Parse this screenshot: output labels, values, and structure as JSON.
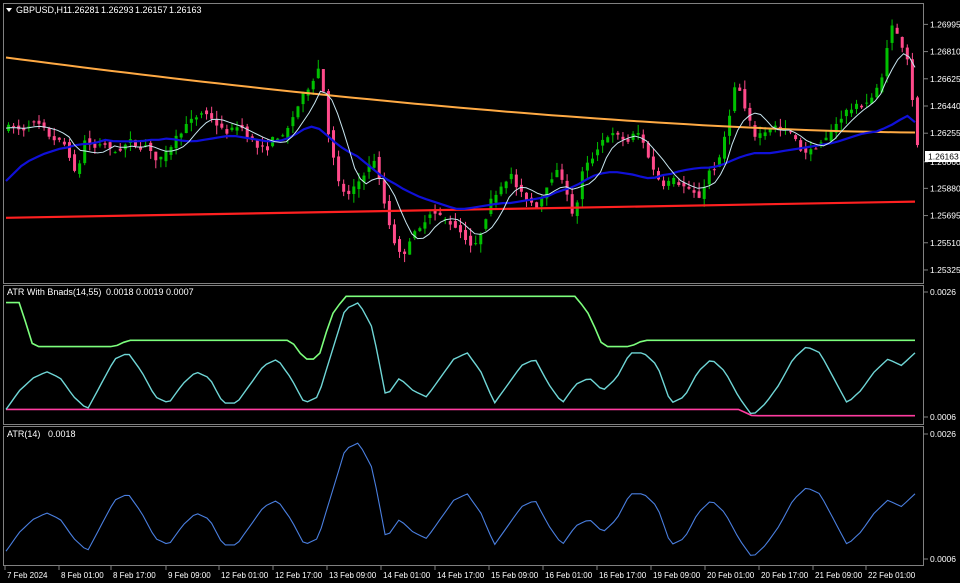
{
  "main": {
    "header": {
      "symbol": "GBPUSD,H1",
      "open": "1.26281",
      "high": "1.26293",
      "low": "1.26157",
      "close": "1.26163"
    },
    "price_levels": [
      "1.26995",
      "1.26810",
      "1.26625",
      "1.26440",
      "1.26255",
      "1.26060",
      "1.25880",
      "1.25695",
      "1.25510",
      "1.25325"
    ],
    "current_price": "1.26163"
  },
  "atr_bands": {
    "name": "ATR With Bnads(14,55)",
    "values": "0.0018 0.0019 0.0007",
    "scale_top": "0.0026",
    "scale_bottom": "0.0006"
  },
  "atr": {
    "name": "ATR(14)",
    "value": "0.0018",
    "scale_top": "0.0026",
    "scale_bottom": "0.0006"
  },
  "time_axis": [
    "7 Feb 2024",
    "8 Feb 01:00",
    "8 Feb 17:00",
    "9 Feb 09:00",
    "12 Feb 01:00",
    "12 Feb 17:00",
    "13 Feb 09:00",
    "14 Feb 01:00",
    "14 Feb 17:00",
    "15 Feb 09:00",
    "16 Feb 01:00",
    "16 Feb 17:00",
    "19 Feb 09:00",
    "20 Feb 01:00",
    "20 Feb 17:00",
    "21 Feb 09:00",
    "22 Feb 01:00"
  ],
  "colors": {
    "background": "#000000",
    "grid": "#808080",
    "bull_candle": "#00c000",
    "bear_candle": "#ff4a8a",
    "ma_fast": "#c8e6f0",
    "ma_blue": "#1010d8",
    "ma_orange": "#ffaa44",
    "ma_red": "#ff2020",
    "atr_line": "#6fd6d6",
    "upper_band": "#7dff7d",
    "lower_band": "#ff3ca0",
    "atr_plain": "#4a7fe0"
  },
  "chart_data": [
    {
      "type": "candlestick",
      "title": "GBPUSD,H1",
      "ylim": [
        1.2525,
        1.2712
      ],
      "close_path": [
        1.2629,
        1.263,
        1.2627,
        1.2633,
        1.2631,
        1.2624,
        1.262,
        1.2617,
        1.2595,
        1.2621,
        1.2615,
        1.262,
        1.2612,
        1.2615,
        1.262,
        1.2616,
        1.2618,
        1.2605,
        1.2612,
        1.2622,
        1.263,
        1.2635,
        1.264,
        1.2636,
        1.2628,
        1.2626,
        1.2632,
        1.2624,
        1.2616,
        1.2614,
        1.2624,
        1.2622,
        1.2637,
        1.265,
        1.266,
        1.2672,
        1.2622,
        1.2592,
        1.2582,
        1.259,
        1.26,
        1.2608,
        1.258,
        1.2555,
        1.254,
        1.2555,
        1.256,
        1.2572,
        1.257,
        1.2566,
        1.2562,
        1.2555,
        1.2546,
        1.2563,
        1.2582,
        1.259,
        1.2598,
        1.2585,
        1.258,
        1.2576,
        1.259,
        1.26,
        1.2593,
        1.2565,
        1.26,
        1.2608,
        1.262,
        1.2625,
        1.2623,
        1.262,
        1.2627,
        1.2615,
        1.2597,
        1.2591,
        1.2594,
        1.259,
        1.2585,
        1.2582,
        1.26,
        1.2604,
        1.2632,
        1.2662,
        1.264,
        1.2624,
        1.2626,
        1.2631,
        1.2628,
        1.2626,
        1.2615,
        1.2612,
        1.2618,
        1.2622,
        1.2632,
        1.264,
        1.2643,
        1.2645,
        1.265,
        1.266,
        1.27,
        1.269,
        1.2675,
        1.2616
      ],
      "ma_blue": [
        1.2593,
        1.2599,
        1.2605,
        1.2608,
        1.2611,
        1.2613,
        1.2615,
        1.2616,
        1.2618,
        1.2618,
        1.2619,
        1.2621,
        1.262,
        1.262,
        1.262,
        1.262,
        1.2621,
        1.2621,
        1.2622,
        1.2621,
        1.262,
        1.262,
        1.2621,
        1.2622,
        1.2623,
        1.2624,
        1.2623,
        1.2622,
        1.2621,
        1.262,
        1.262,
        1.2621,
        1.2624,
        1.2628,
        1.263,
        1.2628,
        1.2622,
        1.2617,
        1.2613,
        1.261,
        1.2605,
        1.26,
        1.2595,
        1.2592,
        1.2588,
        1.2585,
        1.2582,
        1.258,
        1.2578,
        1.2576,
        1.2574,
        1.2574,
        1.2575,
        1.2576,
        1.2577,
        1.2578,
        1.2578,
        1.2579,
        1.258,
        1.2581,
        1.2582,
        1.2585,
        1.2587,
        1.2589,
        1.2592,
        1.2596,
        1.2598,
        1.2599,
        1.2599,
        1.2598,
        1.2597,
        1.2595,
        1.2595,
        1.2597,
        1.2598,
        1.26,
        1.2601,
        1.2602,
        1.2602,
        1.2603,
        1.2605,
        1.2608,
        1.261,
        1.2612,
        1.2612,
        1.2612,
        1.2613,
        1.2614,
        1.2615,
        1.2616,
        1.2617,
        1.2618,
        1.2619,
        1.2621,
        1.2623,
        1.2625,
        1.2626,
        1.2627,
        1.263,
        1.2633,
        1.2638,
        1.2633
      ],
      "ma_orange_start": 1.2677,
      "ma_orange_end": 1.2626,
      "ma_red_start": 1.2568,
      "ma_red_end": 1.2579
    },
    {
      "type": "line",
      "title": "ATR With Bnads(14,55)",
      "ylim": [
        0.0005,
        0.0026
      ],
      "atr": [
        0.0007,
        0.001,
        0.0012,
        0.0013,
        0.0012,
        0.0009,
        0.0007,
        0.0011,
        0.0015,
        0.0016,
        0.0013,
        0.0009,
        0.0008,
        0.0011,
        0.0013,
        0.0012,
        0.0008,
        0.0008,
        0.0011,
        0.0014,
        0.0015,
        0.0012,
        0.0008,
        0.0009,
        0.0016,
        0.0023,
        0.0024,
        0.002,
        0.0009,
        0.0012,
        0.001,
        0.0009,
        0.0012,
        0.0015,
        0.0016,
        0.0013,
        0.0008,
        0.0011,
        0.0014,
        0.0015,
        0.0011,
        0.0008,
        0.0011,
        0.0012,
        0.001,
        0.0012,
        0.0016,
        0.0016,
        0.0014,
        0.0008,
        0.0009,
        0.0013,
        0.0015,
        0.0013,
        0.0009,
        0.0006,
        0.0008,
        0.0011,
        0.0015,
        0.0017,
        0.0016,
        0.0012,
        0.0008,
        0.001,
        0.0013,
        0.0015,
        0.0014,
        0.0016
      ],
      "upper": [
        0.0024,
        0.0024,
        0.0017,
        0.0017,
        0.0017,
        0.0017,
        0.0017,
        0.0017,
        0.0017,
        0.0018,
        0.0018,
        0.0018,
        0.0018,
        0.0018,
        0.0018,
        0.0018,
        0.0018,
        0.0018,
        0.0018,
        0.0018,
        0.0018,
        0.0018,
        0.0015,
        0.0015,
        0.0022,
        0.0025,
        0.0025,
        0.0025,
        0.0025,
        0.0025,
        0.0025,
        0.0025,
        0.0025,
        0.0025,
        0.0025,
        0.0025,
        0.0025,
        0.0025,
        0.0025,
        0.0025,
        0.0025,
        0.0025,
        0.0025,
        0.0022,
        0.0017,
        0.0017,
        0.0017,
        0.0018,
        0.0018,
        0.0018,
        0.0018,
        0.0018,
        0.0018,
        0.0018,
        0.0018,
        0.0018,
        0.0018,
        0.0018,
        0.0018,
        0.0018,
        0.0018,
        0.0018,
        0.0018,
        0.0018,
        0.0018,
        0.0018,
        0.0018,
        0.0018
      ],
      "lower": [
        0.0007,
        0.0007,
        0.0007,
        0.0007,
        0.0007,
        0.0007,
        0.0007,
        0.0007,
        0.0007,
        0.0007,
        0.0007,
        0.0007,
        0.0007,
        0.0007,
        0.0007,
        0.0007,
        0.0007,
        0.0007,
        0.0007,
        0.0007,
        0.0007,
        0.0007,
        0.0007,
        0.0007,
        0.0007,
        0.0007,
        0.0007,
        0.0007,
        0.0007,
        0.0007,
        0.0007,
        0.0007,
        0.0007,
        0.0007,
        0.0007,
        0.0007,
        0.0007,
        0.0007,
        0.0007,
        0.0007,
        0.0007,
        0.0007,
        0.0007,
        0.0007,
        0.0007,
        0.0007,
        0.0007,
        0.0007,
        0.0007,
        0.0007,
        0.0007,
        0.0007,
        0.0007,
        0.0007,
        0.0007,
        0.0006,
        0.0006,
        0.0006,
        0.0006,
        0.0006,
        0.0006,
        0.0006,
        0.0006,
        0.0006,
        0.0006,
        0.0006,
        0.0006,
        0.0006
      ]
    },
    {
      "type": "line",
      "title": "ATR(14)",
      "ylim": [
        0.0005,
        0.0026
      ],
      "atr": [
        0.0007,
        0.001,
        0.0012,
        0.0013,
        0.0012,
        0.0009,
        0.0007,
        0.0011,
        0.0015,
        0.0016,
        0.0013,
        0.0009,
        0.0008,
        0.0011,
        0.0013,
        0.0012,
        0.0008,
        0.0008,
        0.0011,
        0.0014,
        0.0015,
        0.0012,
        0.0008,
        0.0009,
        0.0016,
        0.0023,
        0.0024,
        0.002,
        0.0009,
        0.0012,
        0.001,
        0.0009,
        0.0012,
        0.0015,
        0.0016,
        0.0013,
        0.0008,
        0.0011,
        0.0014,
        0.0015,
        0.0011,
        0.0008,
        0.0011,
        0.0012,
        0.001,
        0.0012,
        0.0016,
        0.0016,
        0.0014,
        0.0008,
        0.0009,
        0.0013,
        0.0015,
        0.0013,
        0.0009,
        0.0006,
        0.0008,
        0.0011,
        0.0015,
        0.0017,
        0.0016,
        0.0012,
        0.0008,
        0.001,
        0.0013,
        0.0015,
        0.0014,
        0.0016
      ]
    }
  ]
}
